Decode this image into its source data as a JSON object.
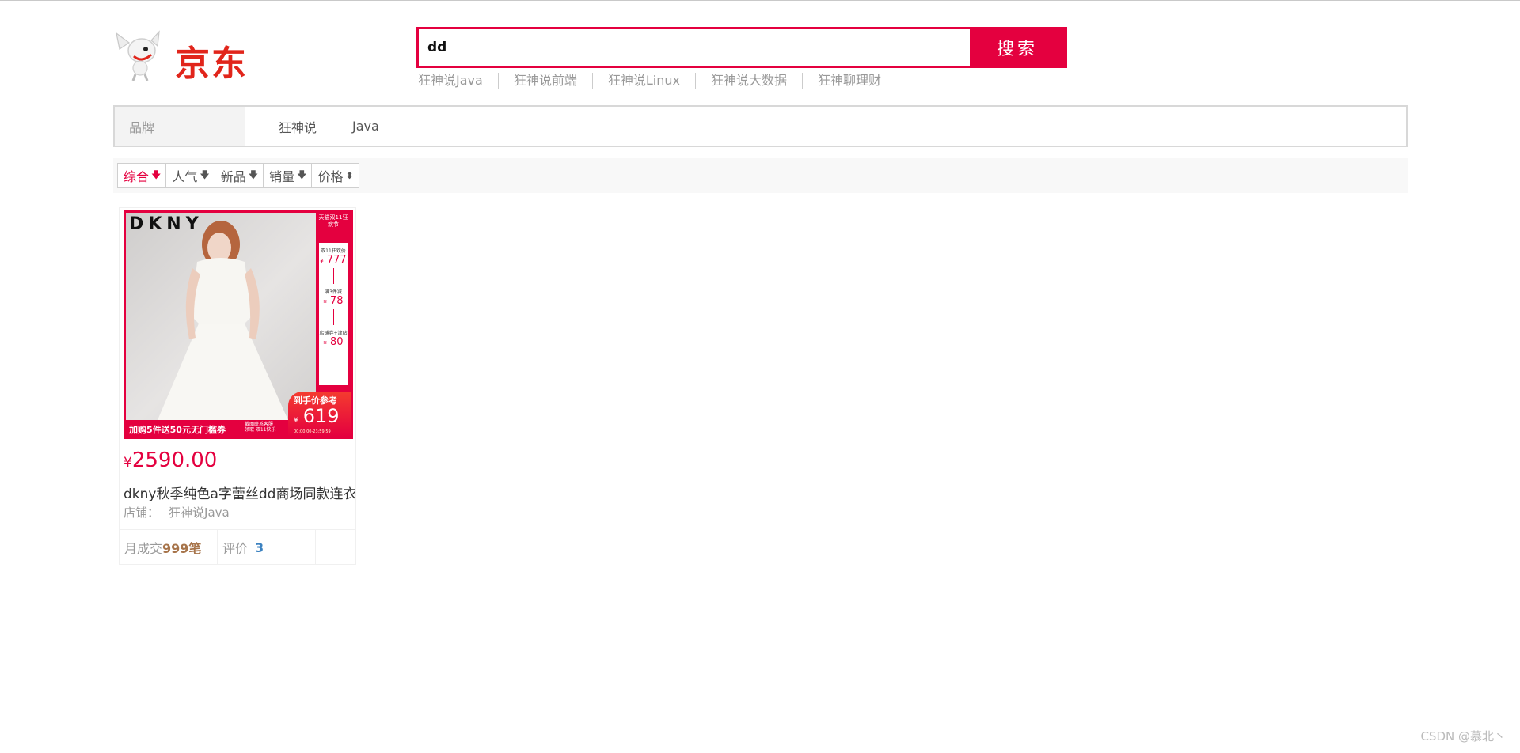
{
  "colors": {
    "accent": "#e4003f",
    "logo_red": "#e1251b",
    "sales": "#a7744a",
    "review": "#3c82c0"
  },
  "header": {
    "logo_text": "京东",
    "search": {
      "value": "dd",
      "placeholder": ""
    },
    "search_button": "搜索",
    "hotwords": [
      "狂神说Java",
      "狂神说前端",
      "狂神说Linux",
      "狂神说大数据",
      "狂神聊理财"
    ]
  },
  "brand_filter": {
    "label": "品牌",
    "items": [
      "狂神说",
      "Java"
    ]
  },
  "sort": [
    {
      "label": "综合",
      "icon": "arrow-down-icon",
      "arrow": "🡇"
    },
    {
      "label": "人气",
      "icon": "arrow-down-icon",
      "arrow": "🡇"
    },
    {
      "label": "新品",
      "icon": "arrow-down-icon",
      "arrow": "🡇"
    },
    {
      "label": "销量",
      "icon": "arrow-down-icon",
      "arrow": "🡇"
    },
    {
      "label": "价格",
      "icon": "sort-updown-icon",
      "arrow": "⬍"
    }
  ],
  "product": {
    "image": {
      "brand": "DKNY",
      "side_top": "天猫双11狂欢节",
      "side_items": [
        {
          "label": "双11狂欢价",
          "currency": "¥",
          "value": "777"
        },
        {
          "label": "满3件减",
          "currency": "¥",
          "value": "78"
        },
        {
          "label": "店铺券+津贴",
          "currency": "¥",
          "value": "80"
        }
      ],
      "strip_text": "加购5件送50元无门槛券",
      "strip_small": [
        "截图联系客服",
        "领取 双11快乐"
      ],
      "final_label": "到手价参考",
      "final_currency": "¥",
      "final_value": "619",
      "final_time": "00:00:00-23:59:59"
    },
    "currency": "¥",
    "price": "2590.00",
    "title": "dkny秋季纯色a字蕾丝dd商场同款连衣",
    "shop_label": "店铺：",
    "shop_name": "狂神说Java",
    "sales_prefix": "月成交",
    "sales_value": "999笔",
    "review_label": "评价",
    "review_count": "3"
  },
  "watermark": "CSDN @慕北丶"
}
